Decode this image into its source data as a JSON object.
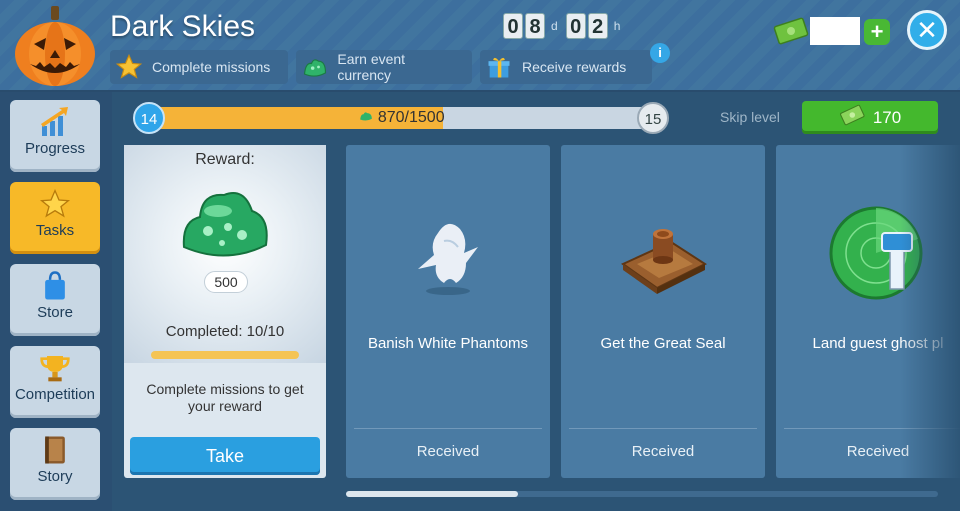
{
  "header": {
    "title": "Dark Skies",
    "steps": [
      {
        "label": "Complete missions",
        "icon": "star-icon"
      },
      {
        "label": "Earn event currency",
        "icon": "slime-icon"
      },
      {
        "label": "Receive rewards",
        "icon": "gift-icon"
      }
    ],
    "timer": {
      "days": [
        "0",
        "8"
      ],
      "days_unit": "d",
      "hours": [
        "0",
        "2"
      ],
      "hours_unit": "h"
    },
    "info_label": "i",
    "plus_label": "+",
    "close_label": "✕"
  },
  "sidebar": {
    "items": [
      {
        "label": "Progress",
        "icon": "progress-arrow-icon",
        "active": false
      },
      {
        "label": "Tasks",
        "icon": "star-icon",
        "active": true
      },
      {
        "label": "Store",
        "icon": "shopping-bag-icon",
        "active": false
      },
      {
        "label": "Competition",
        "icon": "trophy-icon",
        "active": false
      },
      {
        "label": "Story",
        "icon": "book-icon",
        "active": false
      }
    ]
  },
  "level_progress": {
    "current_level": "14",
    "next_level": "15",
    "text": "870/1500",
    "value": 870,
    "max": 1500
  },
  "skip": {
    "label": "Skip level",
    "cost": "170"
  },
  "reward": {
    "label": "Reward:",
    "amount": "500",
    "completed_text": "Completed: 10/10",
    "completed_fraction": 1.0,
    "description": "Complete missions to get your reward",
    "take_label": "Take"
  },
  "tasks": [
    {
      "name": "Banish White Phantoms",
      "status": "Received",
      "icon": "ghost-icon"
    },
    {
      "name": "Get the Great Seal",
      "status": "Received",
      "icon": "seal-icon"
    },
    {
      "name": "Land guest ghost pl",
      "status": "Received",
      "icon": "radar-tower-icon"
    }
  ],
  "colors": {
    "accent_blue": "#2a9fe0",
    "active_tab": "#f7b928",
    "skip_green": "#44b82d",
    "progress_fill": "#f5b338"
  }
}
